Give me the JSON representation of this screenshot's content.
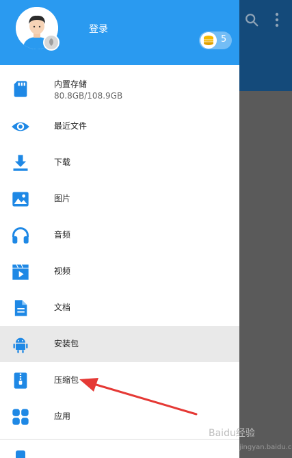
{
  "header": {
    "login": "登录",
    "coins": "5"
  },
  "menu": {
    "items": [
      {
        "label": "内置存储",
        "sub": "80.8GB/108.9GB",
        "icon": "sd-card-icon"
      },
      {
        "label": "最近文件",
        "icon": "eye-icon"
      },
      {
        "label": "下载",
        "icon": "download-icon"
      },
      {
        "label": "图片",
        "icon": "image-icon"
      },
      {
        "label": "音频",
        "icon": "headphones-icon"
      },
      {
        "label": "视频",
        "icon": "video-icon"
      },
      {
        "label": "文档",
        "icon": "document-icon"
      },
      {
        "label": "安装包",
        "icon": "android-icon"
      },
      {
        "label": "压缩包",
        "icon": "zip-icon"
      },
      {
        "label": "应用",
        "icon": "apps-icon"
      }
    ]
  },
  "watermark": {
    "text": "Baidu经验",
    "url": "jingyan.baidu.com"
  },
  "colors": {
    "accent": "#2a9af0",
    "icon": "#1e88e5",
    "arrow": "#e53935",
    "active_row": "#e9e9e9"
  }
}
